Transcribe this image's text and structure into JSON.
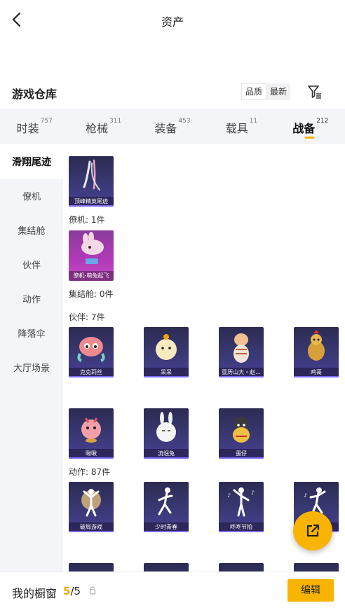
{
  "topbar": {
    "title": "资产"
  },
  "header": {
    "warehouse_title": "游戏仓库",
    "sort": {
      "quality": "品质",
      "newest": "最新"
    }
  },
  "tabs": [
    {
      "label": "时装",
      "count": "757"
    },
    {
      "label": "枪械",
      "count": "311"
    },
    {
      "label": "装备",
      "count": "453"
    },
    {
      "label": "载具",
      "count": "11"
    },
    {
      "label": "战备",
      "count": "212"
    }
  ],
  "sidebar": {
    "items": [
      {
        "label": "滑翔尾迹"
      },
      {
        "label": "僚机"
      },
      {
        "label": "集结舱"
      },
      {
        "label": "伙伴"
      },
      {
        "label": "动作"
      },
      {
        "label": "降落伞"
      },
      {
        "label": "大厅场景"
      }
    ]
  },
  "content": {
    "trail_items": [
      {
        "name": "顶峰精英尾迹"
      }
    ],
    "wingman_label": "僚机: 1件",
    "wingman_items": [
      {
        "name": "僚机-萌兔起飞"
      }
    ],
    "pod_label": "集结舱: 0件",
    "companion_label": "伙伴: 7件",
    "companion_items": [
      {
        "name": "克克莉丝"
      },
      {
        "name": "呆呆"
      },
      {
        "name": "亚历山大・赵..."
      },
      {
        "name": "鸡哥"
      },
      {
        "name": "啾啾"
      },
      {
        "name": "流氓兔"
      },
      {
        "name": "蛋仔"
      }
    ],
    "emote_label": "动作: 87件",
    "emote_items": [
      {
        "name": "破局游戏"
      },
      {
        "name": "少时青春"
      },
      {
        "name": "咚咚节拍"
      }
    ]
  },
  "bottombar": {
    "cabinet_label": "我的橱窗",
    "count_now": "5",
    "count_total": "/5",
    "edit_label": "编辑"
  },
  "colors": {
    "accent": "#f8b400",
    "card": "#3b3a78",
    "card_pink": "#b23ab8"
  }
}
